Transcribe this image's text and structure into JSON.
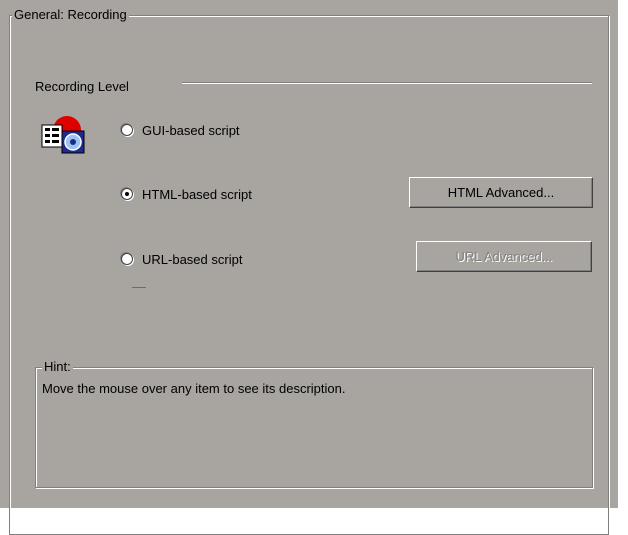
{
  "general_group": {
    "title": "General: Recording"
  },
  "recording_level": {
    "label": "Recording Level"
  },
  "options": [
    {
      "label": "GUI-based script",
      "selected": false
    },
    {
      "label": "HTML-based script",
      "selected": true
    },
    {
      "label": "URL-based script",
      "selected": false
    }
  ],
  "buttons": {
    "html_advanced": "HTML Advanced...",
    "url_advanced": "URL Advanced..."
  },
  "hint": {
    "title": "Hint:",
    "text": "Move the mouse over any item to see its description."
  },
  "icons": {
    "recording_level": "recording-level-icon"
  },
  "colors": {
    "panel": "#a8a4a0",
    "shadow": "#808080",
    "highlight": "#ffffff",
    "accent": "#1b8ca0"
  }
}
